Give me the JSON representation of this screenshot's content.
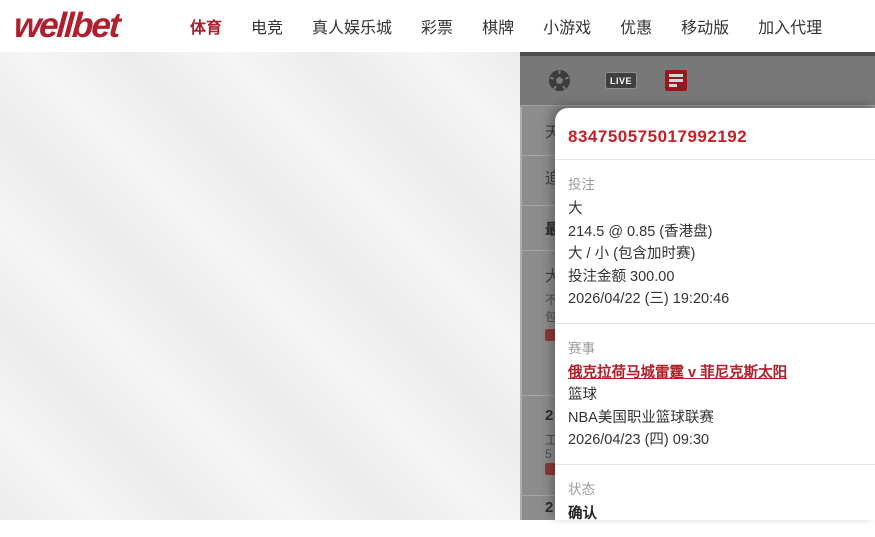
{
  "brand": {
    "logo_text": "wellbet",
    "logo_color": "#b01f2e"
  },
  "nav": {
    "items": [
      {
        "label": "体育",
        "active": true
      },
      {
        "label": "电竞",
        "active": false
      },
      {
        "label": "真人娱乐城",
        "active": false
      },
      {
        "label": "彩票",
        "active": false
      },
      {
        "label": "棋牌",
        "active": false
      },
      {
        "label": "小游戏",
        "active": false
      },
      {
        "label": "优惠",
        "active": false
      },
      {
        "label": "移动版",
        "active": false
      },
      {
        "label": "加入代理",
        "active": false
      }
    ]
  },
  "toolbar": {
    "live_badge_label": "LIVE",
    "icons": [
      "soccer-icon",
      "live-badge",
      "bet-list-icon"
    ]
  },
  "sidebar_occluded_fragments": {
    "note": "partially visible characters of the dimmed bet-list behind the popup",
    "chars": [
      "天",
      "追",
      "最",
      "大",
      "不",
      "包",
      "2",
      "工",
      "5",
      "2"
    ]
  },
  "popup": {
    "bet_id": "834750575017992192",
    "bet": {
      "label": "投注",
      "selection": "大",
      "odds_line": "214.5 @ 0.85 (香港盘)",
      "market": "大 / 小 (包含加时赛)",
      "stake_line": "投注金额 300.00",
      "placed_time": "2026/04/22 (三) 19:20:46"
    },
    "match": {
      "label": "赛事",
      "teams": "俄克拉荷马城雷霆 v 菲尼克斯太阳",
      "sport": "篮球",
      "league": "NBA美国职业篮球联赛",
      "start_time": "2026/04/23 (四) 09:30"
    },
    "status": {
      "label": "状态",
      "value": "确认"
    }
  },
  "colors": {
    "accent_red": "#c42127",
    "link_red": "#b01e28",
    "nav_active": "#a62130",
    "toolbar_bg": "#787878",
    "sidebar_bg": "#8c8c8c",
    "icon_red": "#9c151e",
    "label_gray": "#9b9b9b"
  }
}
